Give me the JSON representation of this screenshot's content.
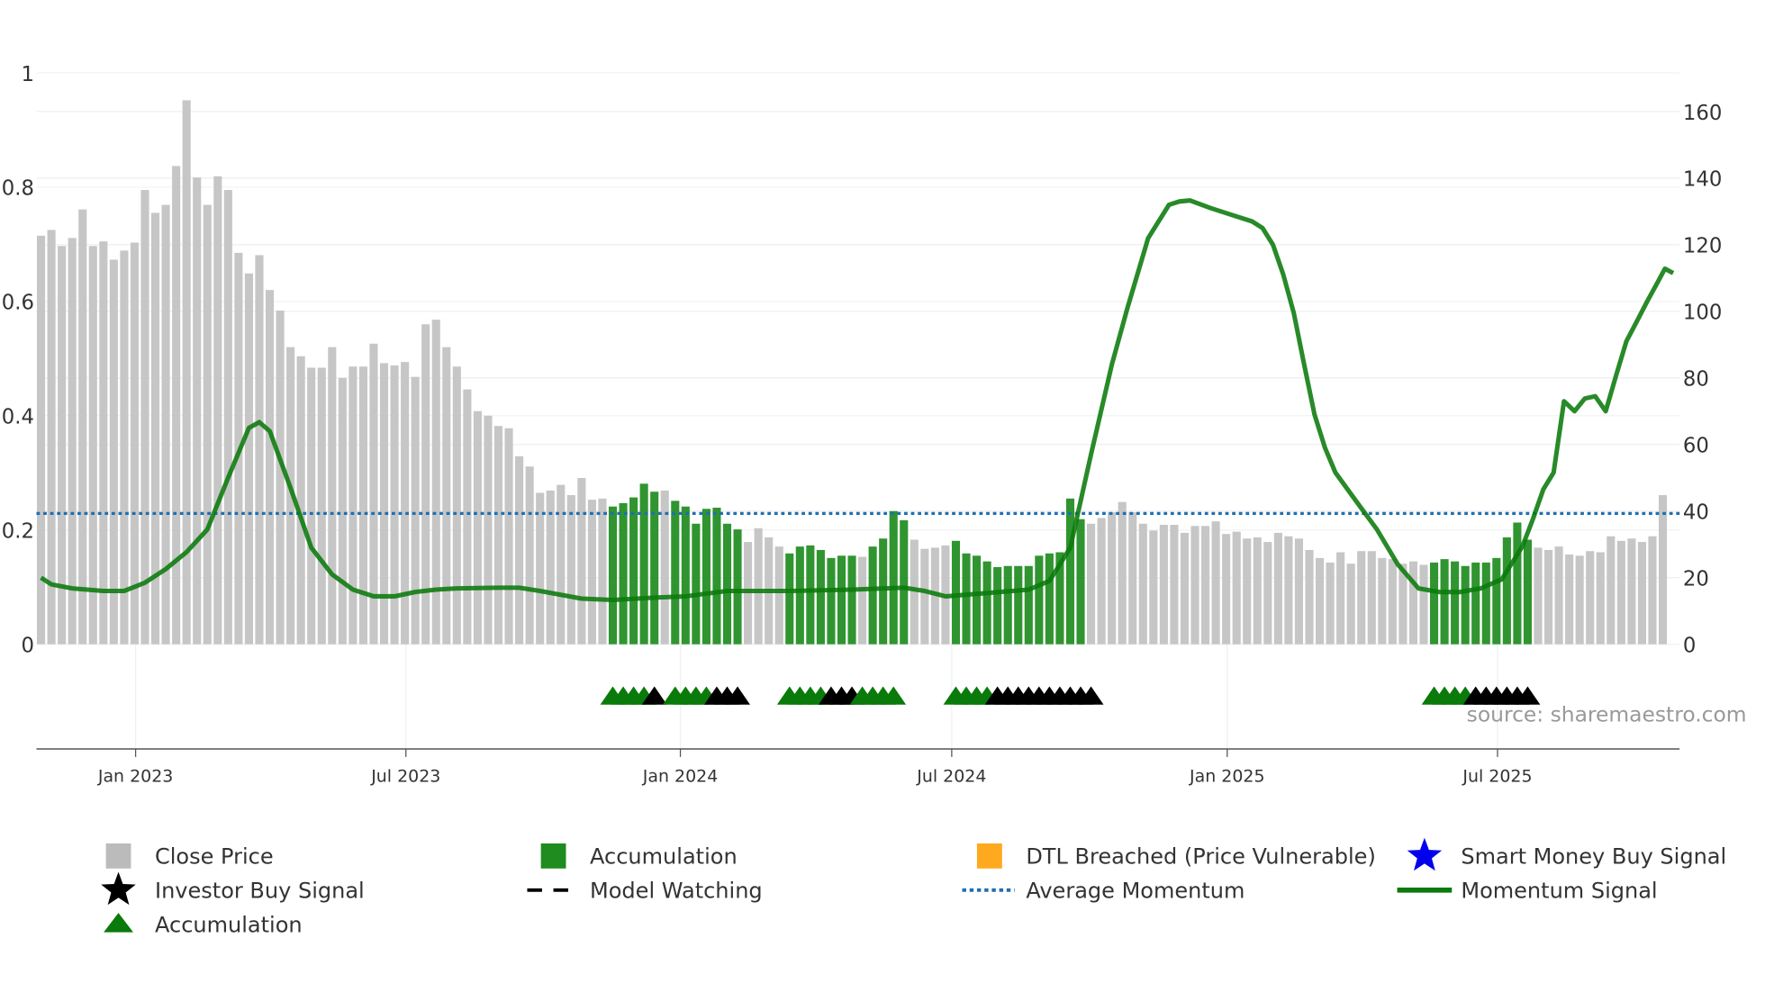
{
  "chart_data": {
    "type": "bar",
    "title": "",
    "source": "source: sharemaestro.com",
    "left_axis": {
      "ylim": [
        0,
        1
      ],
      "ticks": [
        "0",
        "0.2",
        "0.4",
        "0.6",
        "0.8",
        "1"
      ],
      "tick_values": [
        0,
        0.2,
        0.4,
        0.6,
        0.8,
        1
      ]
    },
    "right_axis": {
      "ylim": [
        0,
        160
      ],
      "ticks": [
        "0",
        "20",
        "40",
        "60",
        "80",
        "100",
        "120",
        "140",
        "160"
      ],
      "tick_values": [
        0,
        20,
        40,
        60,
        80,
        100,
        120,
        140,
        160
      ]
    },
    "x_axis": {
      "ticks": [
        "Jan 2023",
        "Jul 2023",
        "Jan 2024",
        "Jul 2024",
        "Jan 2025",
        "Jul 2025"
      ],
      "tick_week_index": [
        9.1,
        35.1,
        61.5,
        87.6,
        114.1,
        140.1
      ]
    },
    "close_price": [
      0.715,
      0.725,
      0.697,
      0.711,
      0.761,
      0.697,
      0.705,
      0.673,
      0.689,
      0.703,
      0.795,
      0.755,
      0.769,
      0.837,
      0.952,
      0.817,
      0.769,
      0.819,
      0.795,
      0.685,
      0.649,
      0.681,
      0.62,
      0.584,
      0.52,
      0.504,
      0.484,
      0.484,
      0.52,
      0.466,
      0.486,
      0.486,
      0.526,
      0.492,
      0.488,
      0.494,
      0.468,
      0.56,
      0.568,
      0.52,
      0.486,
      0.446,
      0.408,
      0.4,
      0.382,
      0.378,
      0.329,
      0.311,
      0.265,
      0.269,
      0.279,
      0.261,
      0.291,
      0.253,
      0.255,
      0.241,
      0.247,
      0.257,
      0.281,
      0.267,
      0.269,
      0.251,
      0.241,
      0.211,
      0.237,
      0.239,
      0.211,
      0.201,
      0.179,
      0.203,
      0.187,
      0.171,
      0.159,
      0.171,
      0.173,
      0.165,
      0.151,
      0.155,
      0.155,
      0.153,
      0.171,
      0.185,
      0.233,
      0.217,
      0.183,
      0.167,
      0.169,
      0.173,
      0.181,
      0.159,
      0.155,
      0.145,
      0.135,
      0.137,
      0.137,
      0.137,
      0.155,
      0.159,
      0.161,
      0.255,
      0.219,
      0.211,
      0.221,
      0.231,
      0.249,
      0.231,
      0.211,
      0.199,
      0.209,
      0.209,
      0.195,
      0.207,
      0.207,
      0.215,
      0.193,
      0.197,
      0.185,
      0.187,
      0.179,
      0.195,
      0.189,
      0.185,
      0.165,
      0.151,
      0.143,
      0.161,
      0.141,
      0.163,
      0.163,
      0.151,
      0.149,
      0.141,
      0.145,
      0.139,
      0.143,
      0.149,
      0.145,
      0.137,
      0.143,
      0.143,
      0.151,
      0.187,
      0.213,
      0.183,
      0.169,
      0.165,
      0.171,
      0.157,
      0.155,
      0.163,
      0.161,
      0.189,
      0.181,
      0.185,
      0.179,
      0.189,
      0.261
    ],
    "accumulation_ranges": [
      [
        55,
        59
      ],
      [
        61,
        67
      ],
      [
        72,
        78
      ],
      [
        80,
        83
      ],
      [
        88,
        100
      ],
      [
        134,
        143
      ]
    ],
    "momentum_signal": [
      [
        0,
        20
      ],
      [
        1,
        18
      ],
      [
        3,
        16.8
      ],
      [
        6,
        16
      ],
      [
        8,
        16
      ],
      [
        10,
        18.5
      ],
      [
        12,
        22.6
      ],
      [
        14,
        27.7
      ],
      [
        16,
        34.5
      ],
      [
        18,
        50
      ],
      [
        20,
        65
      ],
      [
        21,
        66.7
      ],
      [
        22,
        64
      ],
      [
        24,
        47
      ],
      [
        26,
        29
      ],
      [
        28,
        21
      ],
      [
        30,
        16.4
      ],
      [
        32,
        14.4
      ],
      [
        34,
        14.4
      ],
      [
        36,
        15.7
      ],
      [
        38,
        16.4
      ],
      [
        40,
        16.8
      ],
      [
        44,
        17
      ],
      [
        46,
        17
      ],
      [
        48,
        16
      ],
      [
        52,
        13.7
      ],
      [
        55,
        13.3
      ],
      [
        59,
        14
      ],
      [
        62,
        14.4
      ],
      [
        66,
        16
      ],
      [
        72,
        16
      ],
      [
        78,
        16.4
      ],
      [
        83,
        17
      ],
      [
        85,
        16
      ],
      [
        87,
        14.4
      ],
      [
        91,
        15.4
      ],
      [
        95,
        16.4
      ],
      [
        97,
        19
      ],
      [
        99,
        29
      ],
      [
        101,
        57
      ],
      [
        103,
        84
      ],
      [
        104.5,
        101
      ],
      [
        106.5,
        122
      ],
      [
        108.5,
        132
      ],
      [
        109.5,
        133
      ],
      [
        110.5,
        133.3
      ],
      [
        112.5,
        131
      ],
      [
        114.5,
        129
      ],
      [
        116.5,
        127
      ],
      [
        117.5,
        125
      ],
      [
        118.5,
        120
      ],
      [
        119.5,
        111
      ],
      [
        120.5,
        99.5
      ],
      [
        121.5,
        84
      ],
      [
        122.5,
        69
      ],
      [
        123.5,
        59
      ],
      [
        124.5,
        51.6
      ],
      [
        126.5,
        43
      ],
      [
        128.5,
        34.5
      ],
      [
        130.5,
        24
      ],
      [
        132.5,
        16.8
      ],
      [
        134.5,
        15.7
      ],
      [
        136.5,
        15.7
      ],
      [
        138.5,
        16.8
      ],
      [
        140.5,
        19.5
      ],
      [
        142.5,
        29.4
      ],
      [
        143.5,
        37.6
      ],
      [
        144.5,
        46.5
      ],
      [
        145.5,
        51.6
      ],
      [
        146.5,
        73
      ],
      [
        147.5,
        70
      ],
      [
        148.5,
        73.8
      ],
      [
        149.5,
        74.5
      ],
      [
        150.5,
        70
      ],
      [
        151.5,
        80.7
      ],
      [
        152.5,
        91
      ],
      [
        153.5,
        97
      ],
      [
        154.5,
        103
      ],
      [
        155.5,
        108.7
      ],
      [
        156.2,
        112.8
      ],
      [
        157,
        111.5
      ]
    ],
    "average_momentum": 39.3,
    "signal_markers": [
      [
        55,
        "acc"
      ],
      [
        56,
        "acc"
      ],
      [
        57,
        "acc"
      ],
      [
        58,
        "acc"
      ],
      [
        59,
        "investor"
      ],
      [
        61,
        "acc"
      ],
      [
        62,
        "acc"
      ],
      [
        63,
        "acc"
      ],
      [
        64,
        "acc"
      ],
      [
        65,
        "investor"
      ],
      [
        66,
        "investor"
      ],
      [
        67,
        "investor"
      ],
      [
        72,
        "acc"
      ],
      [
        73,
        "acc"
      ],
      [
        74,
        "acc"
      ],
      [
        75,
        "acc"
      ],
      [
        76,
        "investor"
      ],
      [
        77,
        "investor"
      ],
      [
        78,
        "investor"
      ],
      [
        79,
        "acc"
      ],
      [
        80,
        "acc"
      ],
      [
        81,
        "acc"
      ],
      [
        82,
        "acc"
      ],
      [
        88,
        "acc"
      ],
      [
        89,
        "acc"
      ],
      [
        90,
        "acc"
      ],
      [
        91,
        "acc"
      ],
      [
        92,
        "investor"
      ],
      [
        93,
        "investor"
      ],
      [
        94,
        "investor"
      ],
      [
        95,
        "investor"
      ],
      [
        96,
        "investor"
      ],
      [
        97,
        "investor"
      ],
      [
        98,
        "investor"
      ],
      [
        99,
        "investor"
      ],
      [
        100,
        "investor"
      ],
      [
        101,
        "investor"
      ],
      [
        134,
        "acc"
      ],
      [
        135,
        "acc"
      ],
      [
        136,
        "acc"
      ],
      [
        137,
        "acc"
      ],
      [
        138,
        "investor"
      ],
      [
        139,
        "investor"
      ],
      [
        140,
        "investor"
      ],
      [
        141,
        "investor"
      ],
      [
        142,
        "investor"
      ],
      [
        143,
        "investor"
      ]
    ],
    "legend": [
      {
        "label": "Close Price",
        "symbol": "square",
        "color": "#bbbbbb"
      },
      {
        "label": "Accumulation",
        "symbol": "square",
        "color": "#1e8c1e"
      },
      {
        "label": "DTL Breached (Price Vulnerable)",
        "symbol": "square",
        "color": "#ffa91f"
      },
      {
        "label": "Smart Money Buy Signal",
        "symbol": "star",
        "color": "#0000ee"
      },
      {
        "label": "Investor Buy Signal",
        "symbol": "star",
        "color": "#000000"
      },
      {
        "label": "Model Watching",
        "symbol": "dash",
        "color": "#000000"
      },
      {
        "label": "Average Momentum",
        "symbol": "dot",
        "color": "#1f6fb0"
      },
      {
        "label": "Momentum Signal",
        "symbol": "line",
        "color": "#0a7a0a"
      },
      {
        "label": "Accumulation",
        "symbol": "triangle",
        "color": "#0a7a0a"
      }
    ],
    "legend_placement": "bottom"
  }
}
